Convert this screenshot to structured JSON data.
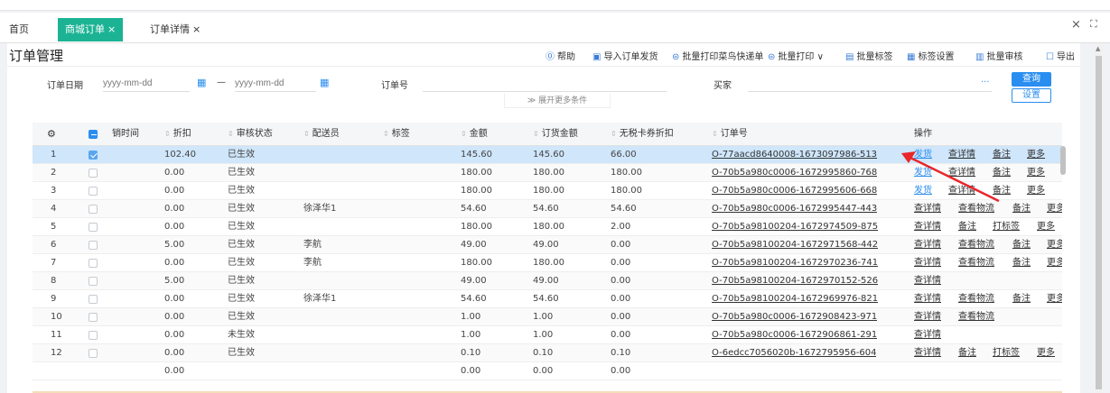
{
  "tabs": [
    {
      "label": "首页",
      "closable": false
    },
    {
      "label": "商城订单",
      "closable": true,
      "active": true
    },
    {
      "label": "订单详情",
      "closable": true
    }
  ],
  "window": {
    "close": "×",
    "expand": "⛶"
  },
  "header": {
    "title": "订单管理",
    "tools": [
      "帮助",
      "导入订单发货",
      "批量打印菜鸟快递单",
      "批量打印 ∨",
      "批量标签",
      "标签设置",
      "批量审核",
      "导出"
    ]
  },
  "filter": {
    "date_label": "订单日期",
    "date_from_placeholder": "yyyy-mm-dd",
    "date_sep": "—",
    "date_to_placeholder": "yyyy-mm-dd",
    "order_no_label": "订单号",
    "buyer_label": "买家",
    "more_dots": "···",
    "query_button": "查询",
    "settings_button": "设置",
    "expand_label": "≫ 展开更多条件"
  },
  "table": {
    "columns": [
      "销时间",
      "折扣",
      "审核状态",
      "配送员",
      "标签",
      "金额",
      "订货金额",
      "无税卡券折扣",
      "订单号",
      "操作"
    ],
    "rows": [
      {
        "no": "1",
        "checked": true,
        "discount": "102.40",
        "status": "已生效",
        "courier": "",
        "amount": "145.60",
        "order_amount": "145.60",
        "coupon": "66.00",
        "order_no": "O-77aacd8640008-1673097986-513",
        "ops": [
          "发货",
          "查详情",
          "备注",
          "更多"
        ]
      },
      {
        "no": "2",
        "checked": false,
        "discount": "0.00",
        "status": "已生效",
        "courier": "",
        "amount": "180.00",
        "order_amount": "180.00",
        "coupon": "180.00",
        "order_no": "O-70b5a980c0006-1672995860-768",
        "ops": [
          "发货",
          "查详情",
          "备注",
          "更多"
        ]
      },
      {
        "no": "3",
        "checked": false,
        "discount": "0.00",
        "status": "已生效",
        "courier": "",
        "amount": "180.00",
        "order_amount": "180.00",
        "coupon": "180.00",
        "order_no": "O-70b5a980c0006-1672995606-668",
        "ops": [
          "发货",
          "查详情",
          "备注",
          "更多"
        ]
      },
      {
        "no": "4",
        "checked": false,
        "discount": "0.00",
        "status": "已生效",
        "courier": "徐泽华1",
        "amount": "54.60",
        "order_amount": "54.60",
        "coupon": "54.60",
        "order_no": "O-70b5a980c0006-1672995447-443",
        "ops": [
          "查详情",
          "查看物流",
          "备注",
          "更多"
        ]
      },
      {
        "no": "5",
        "checked": false,
        "discount": "0.00",
        "status": "已生效",
        "courier": "",
        "amount": "180.00",
        "order_amount": "180.00",
        "coupon": "2.00",
        "order_no": "O-70b5a98100204-1672974509-875",
        "ops": [
          "查详情",
          "备注",
          "打标签",
          "更多"
        ]
      },
      {
        "no": "6",
        "checked": false,
        "discount": "5.00",
        "status": "已生效",
        "courier": "李航",
        "amount": "49.00",
        "order_amount": "49.00",
        "coupon": "0.00",
        "order_no": "O-70b5a98100204-1672971568-442",
        "ops": [
          "查详情",
          "查看物流",
          "备注",
          "更多"
        ]
      },
      {
        "no": "7",
        "checked": false,
        "discount": "0.00",
        "status": "已生效",
        "courier": "李航",
        "amount": "180.00",
        "order_amount": "180.00",
        "coupon": "0.00",
        "order_no": "O-70b5a98100204-1672970236-741",
        "ops": [
          "查详情",
          "查看物流",
          "备注",
          "更多"
        ]
      },
      {
        "no": "8",
        "checked": false,
        "discount": "5.00",
        "status": "已生效",
        "courier": "",
        "amount": "49.00",
        "order_amount": "49.00",
        "coupon": "0.00",
        "order_no": "O-70b5a98100204-1672970152-526",
        "ops": [
          "查详情"
        ]
      },
      {
        "no": "9",
        "checked": false,
        "discount": "0.00",
        "status": "已生效",
        "courier": "徐泽华1",
        "amount": "54.60",
        "order_amount": "54.60",
        "coupon": "0.00",
        "order_no": "O-70b5a98100204-1672969976-821",
        "ops": [
          "查详情",
          "查看物流",
          "备注",
          "更多"
        ]
      },
      {
        "no": "10",
        "checked": false,
        "discount": "0.00",
        "status": "已生效",
        "courier": "",
        "amount": "1.00",
        "order_amount": "1.00",
        "coupon": "0.00",
        "order_no": "O-70b5a980c0006-1672908423-971",
        "ops": [
          "查详情",
          "查看物流"
        ]
      },
      {
        "no": "11",
        "checked": false,
        "discount": "0.00",
        "status": "未生效",
        "courier": "",
        "amount": "1.00",
        "order_amount": "1.00",
        "coupon": "0.00",
        "order_no": "O-70b5a980c0006-1672906861-291",
        "ops": [
          "查详情"
        ]
      },
      {
        "no": "12",
        "checked": false,
        "discount": "0.00",
        "status": "已生效",
        "courier": "",
        "amount": "0.10",
        "order_amount": "0.10",
        "coupon": "0.10",
        "order_no": "O-6edcc7056020b-1672795956-604",
        "ops": [
          "查详情",
          "备注",
          "打标签",
          "更多"
        ]
      }
    ],
    "totals": {
      "discount": "0.00",
      "amount": "0.00",
      "order_amount": "0.00",
      "coupon": "0.00"
    }
  },
  "colors": {
    "accent": "#2a8ef0",
    "tab_active": "#1bb394",
    "selected_row": "#cfe6fb",
    "arrow": "#e8262b"
  }
}
